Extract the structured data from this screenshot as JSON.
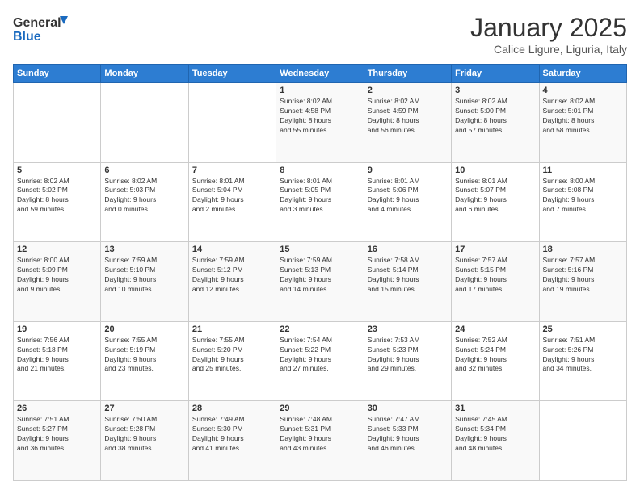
{
  "logo": {
    "line1": "General",
    "line2": "Blue"
  },
  "title": "January 2025",
  "subtitle": "Calice Ligure, Liguria, Italy",
  "weekdays": [
    "Sunday",
    "Monday",
    "Tuesday",
    "Wednesday",
    "Thursday",
    "Friday",
    "Saturday"
  ],
  "weeks": [
    [
      {
        "day": "",
        "info": ""
      },
      {
        "day": "",
        "info": ""
      },
      {
        "day": "",
        "info": ""
      },
      {
        "day": "1",
        "info": "Sunrise: 8:02 AM\nSunset: 4:58 PM\nDaylight: 8 hours\nand 55 minutes."
      },
      {
        "day": "2",
        "info": "Sunrise: 8:02 AM\nSunset: 4:59 PM\nDaylight: 8 hours\nand 56 minutes."
      },
      {
        "day": "3",
        "info": "Sunrise: 8:02 AM\nSunset: 5:00 PM\nDaylight: 8 hours\nand 57 minutes."
      },
      {
        "day": "4",
        "info": "Sunrise: 8:02 AM\nSunset: 5:01 PM\nDaylight: 8 hours\nand 58 minutes."
      }
    ],
    [
      {
        "day": "5",
        "info": "Sunrise: 8:02 AM\nSunset: 5:02 PM\nDaylight: 8 hours\nand 59 minutes."
      },
      {
        "day": "6",
        "info": "Sunrise: 8:02 AM\nSunset: 5:03 PM\nDaylight: 9 hours\nand 0 minutes."
      },
      {
        "day": "7",
        "info": "Sunrise: 8:01 AM\nSunset: 5:04 PM\nDaylight: 9 hours\nand 2 minutes."
      },
      {
        "day": "8",
        "info": "Sunrise: 8:01 AM\nSunset: 5:05 PM\nDaylight: 9 hours\nand 3 minutes."
      },
      {
        "day": "9",
        "info": "Sunrise: 8:01 AM\nSunset: 5:06 PM\nDaylight: 9 hours\nand 4 minutes."
      },
      {
        "day": "10",
        "info": "Sunrise: 8:01 AM\nSunset: 5:07 PM\nDaylight: 9 hours\nand 6 minutes."
      },
      {
        "day": "11",
        "info": "Sunrise: 8:00 AM\nSunset: 5:08 PM\nDaylight: 9 hours\nand 7 minutes."
      }
    ],
    [
      {
        "day": "12",
        "info": "Sunrise: 8:00 AM\nSunset: 5:09 PM\nDaylight: 9 hours\nand 9 minutes."
      },
      {
        "day": "13",
        "info": "Sunrise: 7:59 AM\nSunset: 5:10 PM\nDaylight: 9 hours\nand 10 minutes."
      },
      {
        "day": "14",
        "info": "Sunrise: 7:59 AM\nSunset: 5:12 PM\nDaylight: 9 hours\nand 12 minutes."
      },
      {
        "day": "15",
        "info": "Sunrise: 7:59 AM\nSunset: 5:13 PM\nDaylight: 9 hours\nand 14 minutes."
      },
      {
        "day": "16",
        "info": "Sunrise: 7:58 AM\nSunset: 5:14 PM\nDaylight: 9 hours\nand 15 minutes."
      },
      {
        "day": "17",
        "info": "Sunrise: 7:57 AM\nSunset: 5:15 PM\nDaylight: 9 hours\nand 17 minutes."
      },
      {
        "day": "18",
        "info": "Sunrise: 7:57 AM\nSunset: 5:16 PM\nDaylight: 9 hours\nand 19 minutes."
      }
    ],
    [
      {
        "day": "19",
        "info": "Sunrise: 7:56 AM\nSunset: 5:18 PM\nDaylight: 9 hours\nand 21 minutes."
      },
      {
        "day": "20",
        "info": "Sunrise: 7:55 AM\nSunset: 5:19 PM\nDaylight: 9 hours\nand 23 minutes."
      },
      {
        "day": "21",
        "info": "Sunrise: 7:55 AM\nSunset: 5:20 PM\nDaylight: 9 hours\nand 25 minutes."
      },
      {
        "day": "22",
        "info": "Sunrise: 7:54 AM\nSunset: 5:22 PM\nDaylight: 9 hours\nand 27 minutes."
      },
      {
        "day": "23",
        "info": "Sunrise: 7:53 AM\nSunset: 5:23 PM\nDaylight: 9 hours\nand 29 minutes."
      },
      {
        "day": "24",
        "info": "Sunrise: 7:52 AM\nSunset: 5:24 PM\nDaylight: 9 hours\nand 32 minutes."
      },
      {
        "day": "25",
        "info": "Sunrise: 7:51 AM\nSunset: 5:26 PM\nDaylight: 9 hours\nand 34 minutes."
      }
    ],
    [
      {
        "day": "26",
        "info": "Sunrise: 7:51 AM\nSunset: 5:27 PM\nDaylight: 9 hours\nand 36 minutes."
      },
      {
        "day": "27",
        "info": "Sunrise: 7:50 AM\nSunset: 5:28 PM\nDaylight: 9 hours\nand 38 minutes."
      },
      {
        "day": "28",
        "info": "Sunrise: 7:49 AM\nSunset: 5:30 PM\nDaylight: 9 hours\nand 41 minutes."
      },
      {
        "day": "29",
        "info": "Sunrise: 7:48 AM\nSunset: 5:31 PM\nDaylight: 9 hours\nand 43 minutes."
      },
      {
        "day": "30",
        "info": "Sunrise: 7:47 AM\nSunset: 5:33 PM\nDaylight: 9 hours\nand 46 minutes."
      },
      {
        "day": "31",
        "info": "Sunrise: 7:45 AM\nSunset: 5:34 PM\nDaylight: 9 hours\nand 48 minutes."
      },
      {
        "day": "",
        "info": ""
      }
    ]
  ]
}
